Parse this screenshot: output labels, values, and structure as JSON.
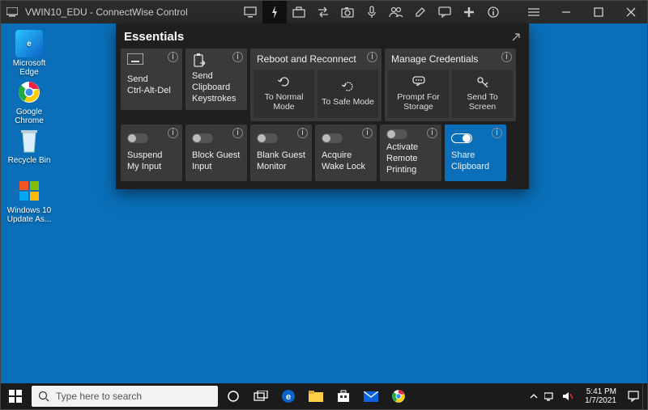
{
  "window": {
    "title": "VWIN10_EDU - ConnectWise Control"
  },
  "panel": {
    "title": "Essentials",
    "row1": {
      "send_cad": "Send\nCtrl-Alt-Del",
      "send_clip": "Send Clipboard Keystrokes",
      "reboot": {
        "header": "Reboot and Reconnect",
        "normal": "To Normal Mode",
        "safe": "To Safe Mode"
      },
      "creds": {
        "header": "Manage Credentials",
        "prompt": "Prompt For Storage",
        "send": "Send To Screen"
      }
    },
    "row2": {
      "suspend": "Suspend My Input",
      "block": "Block Guest Input",
      "blank": "Blank Guest Monitor",
      "wake": "Acquire Wake Lock",
      "print": "Activate Remote Printing",
      "share": "Share Clipboard"
    }
  },
  "desktop_icons": {
    "edge": "Microsoft Edge",
    "chrome": "Google Chrome",
    "recycle": "Recycle Bin",
    "update": "Windows 10 Update As..."
  },
  "taskbar": {
    "search_placeholder": "Type here to search",
    "time": "5:41 PM",
    "date": "1/7/2021"
  }
}
